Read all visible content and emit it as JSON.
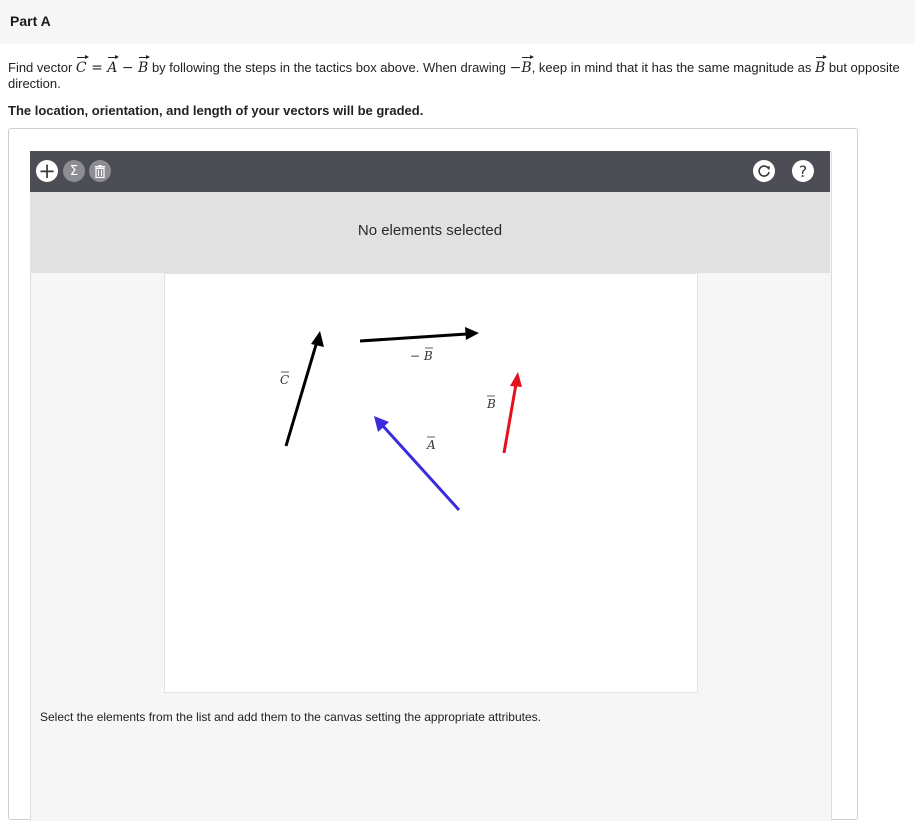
{
  "part": {
    "title": "Part A"
  },
  "prompt": {
    "intro": "Find vector ",
    "eq_c": "C",
    "eq_equals": " = ",
    "eq_a": "A",
    "eq_minus": " − ",
    "eq_b": "B",
    "middle": " by following the steps in the tactics box above. When drawing ",
    "neg_minus": "−",
    "neg_b": "B",
    "after_neg": ", keep in mind that it has the same magnitude as ",
    "same_b": "B",
    "end": " but opposite direction.",
    "graded": "The location, orientation, and length of your vectors will be graded."
  },
  "toolbar": {
    "add_icon": "plus-icon",
    "add_glyph": "+",
    "sum_icon": "sigma-icon",
    "sum_glyph": "Σ",
    "delete_icon": "trash-icon",
    "reset_icon": "reset-icon",
    "help_icon": "help-icon",
    "help_glyph": "?"
  },
  "selection": {
    "status": "No elements selected"
  },
  "canvas": {
    "vectors": [
      {
        "label": "C",
        "prefix": "",
        "color": "#000000",
        "name": "vector-c"
      },
      {
        "label": "B",
        "prefix": "− ",
        "color": "#000000",
        "name": "vector-neg-b"
      },
      {
        "label": "A",
        "prefix": "",
        "color": "#3b2bdf",
        "name": "vector-a"
      },
      {
        "label": "B",
        "prefix": "",
        "color": "#e8101c",
        "name": "vector-b"
      }
    ]
  },
  "instructions": "Select the elements from the list and add them to the canvas setting the appropriate attributes.",
  "colors": {
    "toolbar": "#4c4d55",
    "vector_a": "#3b2bdf",
    "vector_b": "#e8101c",
    "vector_black": "#000000"
  }
}
